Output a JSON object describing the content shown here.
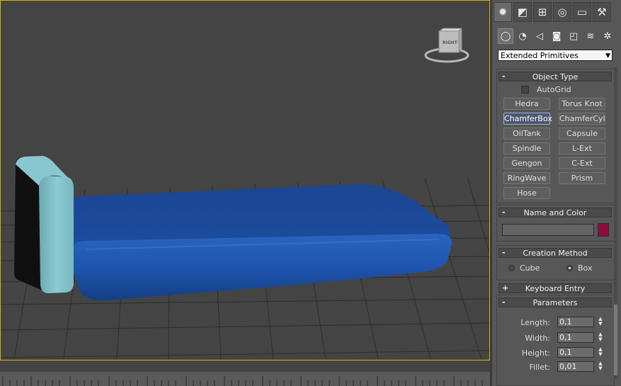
{
  "command_panel": {
    "top_tabs": [
      {
        "icon": "create-icon",
        "glyph": "✹"
      },
      {
        "icon": "modify-icon",
        "glyph": "◩"
      },
      {
        "icon": "hierarchy-icon",
        "glyph": "⊞"
      },
      {
        "icon": "motion-icon",
        "glyph": "◎"
      },
      {
        "icon": "display-icon",
        "glyph": "▭"
      },
      {
        "icon": "utilities-icon",
        "glyph": "⚒"
      }
    ],
    "sub_tabs": [
      {
        "icon": "geometry-icon",
        "glyph": "◯"
      },
      {
        "icon": "shapes-icon",
        "glyph": "◔"
      },
      {
        "icon": "lights-icon",
        "glyph": "◁"
      },
      {
        "icon": "cameras-icon",
        "glyph": "◙"
      },
      {
        "icon": "helpers-icon",
        "glyph": "◰"
      },
      {
        "icon": "space-warps-icon",
        "glyph": "≋"
      },
      {
        "icon": "systems-icon",
        "glyph": "✲"
      }
    ],
    "category_dropdown": "Extended Primitives",
    "object_type": {
      "title": "Object Type",
      "collapse_sign": "-",
      "autogrid_label": "AutoGrid",
      "buttons": [
        "Hedra",
        "Torus Knot",
        "ChamferBox",
        "ChamferCyl",
        "OilTank",
        "Capsule",
        "Spindle",
        "L-Ext",
        "Gengon",
        "C-Ext",
        "RingWave",
        "Prism",
        "Hose"
      ]
    },
    "name_and_color": {
      "title": "Name and Color",
      "collapse_sign": "-",
      "name_value": "",
      "swatch_color": "#8a0f3c"
    },
    "creation_method": {
      "title": "Creation Method",
      "collapse_sign": "-",
      "options": [
        "Cube",
        "Box"
      ]
    },
    "keyboard_entry": {
      "title": "Keyboard Entry",
      "collapse_sign": "+"
    },
    "parameters": {
      "title": "Parameters",
      "collapse_sign": "-",
      "fields": [
        {
          "label": "Length:",
          "value": "0,1"
        },
        {
          "label": "Width:",
          "value": "0,1"
        },
        {
          "label": "Height:",
          "value": "0,1"
        },
        {
          "label": "Fillet:",
          "value": "0,01"
        }
      ]
    }
  },
  "viewport": {
    "viewcube_label": "RIGHT",
    "active_border_color": "#d8b400",
    "mattress_color": "#1a4a9a",
    "headboard_color": "#7fc0c8"
  }
}
